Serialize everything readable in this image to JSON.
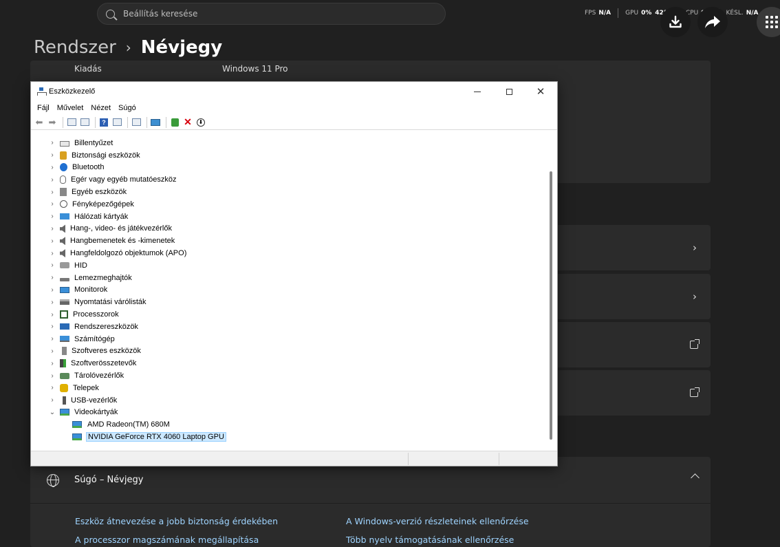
{
  "topbar": {
    "search_placeholder": "Beállítás keresése",
    "perf": {
      "fps_label": "FPS",
      "fps_value": "N/A",
      "gpu_label": "GPU",
      "gpu_value": "0%",
      "gpu_temp": "42°C",
      "cpu_label": "CPU",
      "cpu_value": "9%",
      "lat_label": "KÉSL.",
      "lat_value": "N/A"
    }
  },
  "breadcrumb": {
    "parent": "Rendszer",
    "separator": "›",
    "current": "Névjegy"
  },
  "specs": {
    "edition_label": "Kiadás",
    "edition_value": "Windows 11 Pro"
  },
  "help": {
    "title": "Súgó – Névjegy",
    "links": [
      "Eszköz átnevezése a jobb biztonság érdekében",
      "A Windows-verzió részleteinek ellenőrzése",
      "A processzor magszámának megállapítása",
      "Több nyelv támogatásának ellenőrzése"
    ]
  },
  "devmgr": {
    "title": "Eszközkezelő",
    "menu": [
      "Fájl",
      "Művelet",
      "Nézet",
      "Súgó"
    ],
    "categories": [
      {
        "label": "Billentyűzet",
        "icon": "kbd"
      },
      {
        "label": "Biztonsági eszközök",
        "icon": "lock"
      },
      {
        "label": "Bluetooth",
        "icon": "bt"
      },
      {
        "label": "Egér vagy egyéb mutatóeszköz",
        "icon": "mouse"
      },
      {
        "label": "Egyéb eszközök",
        "icon": "other"
      },
      {
        "label": "Fényképezőgépek",
        "icon": "cam"
      },
      {
        "label": "Hálózati kártyák",
        "icon": "net"
      },
      {
        "label": "Hang-, video- és játékvezérlők",
        "icon": "spk"
      },
      {
        "label": "Hangbemenetek és -kimenetek",
        "icon": "spk"
      },
      {
        "label": "Hangfeldolgozó objektumok (APO)",
        "icon": "spk"
      },
      {
        "label": "HID",
        "icon": "hid"
      },
      {
        "label": "Lemezmeghajtók",
        "icon": "disk"
      },
      {
        "label": "Monitorok",
        "icon": "mon"
      },
      {
        "label": "Nyomtatási várólisták",
        "icon": "prn"
      },
      {
        "label": "Processzorok",
        "icon": "cpu"
      },
      {
        "label": "Rendszereszközök",
        "icon": "sys"
      },
      {
        "label": "Számítógép",
        "icon": "pc"
      },
      {
        "label": "Szoftveres eszközök",
        "icon": "sw"
      },
      {
        "label": "Szoftverösszetevők",
        "icon": "swc"
      },
      {
        "label": "Tárolóvezérlők",
        "icon": "stor"
      },
      {
        "label": "Telepek",
        "icon": "bat"
      },
      {
        "label": "USB-vezérlők",
        "icon": "usb"
      },
      {
        "label": "Videokártyák",
        "icon": "disp",
        "expanded": true,
        "children": [
          {
            "label": "AMD Radeon(TM) 680M"
          },
          {
            "label": "NVIDIA GeForce RTX 4060 Laptop GPU",
            "selected": true
          }
        ]
      }
    ]
  }
}
